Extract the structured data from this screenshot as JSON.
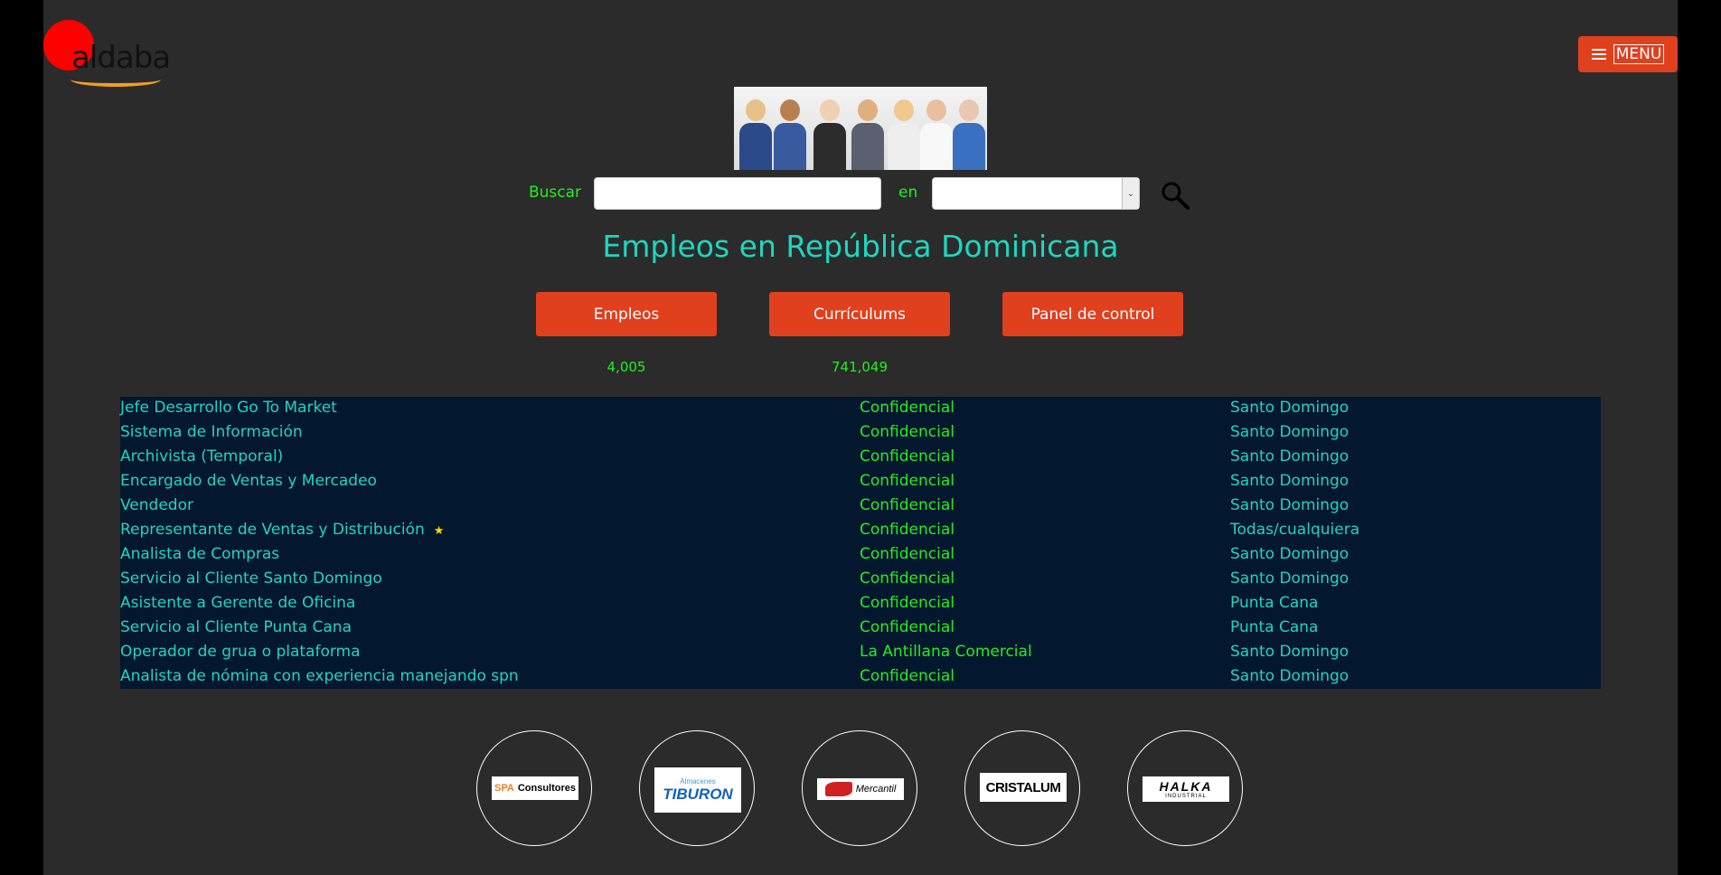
{
  "header": {
    "logo_text": "aldaba",
    "menu_label": "MENU"
  },
  "search": {
    "label": "Buscar",
    "query_value": "",
    "en_label": "en",
    "location_value": ""
  },
  "title": "Empleos en República Dominicana",
  "nav": {
    "jobs_label": "Empleos",
    "jobs_count": "4,005",
    "cv_label": "Currículums",
    "cv_count": "741,049",
    "panel_label": "Panel de control"
  },
  "jobs": [
    {
      "title": "Jefe Desarrollo Go To Market",
      "company": "Confidencial",
      "location": "Santo Domingo"
    },
    {
      "title": "Sistema de Información",
      "company": "Confidencial",
      "location": "Santo Domingo"
    },
    {
      "title": "Archivista (Temporal)",
      "company": "Confidencial",
      "location": "Santo Domingo"
    },
    {
      "title": "Encargado de Ventas y Mercadeo",
      "company": "Confidencial",
      "location": "Santo Domingo"
    },
    {
      "title": "Vendedor",
      "company": "Confidencial",
      "location": "Santo Domingo"
    },
    {
      "title": "Representante de Ventas y Distribución",
      "company": "Confidencial",
      "location": "Todas/cualquiera",
      "featured": true
    },
    {
      "title": "Analista de Compras",
      "company": "Confidencial",
      "location": "Santo Domingo"
    },
    {
      "title": "Servicio al Cliente Santo Domingo",
      "company": "Confidencial",
      "location": "Santo Domingo"
    },
    {
      "title": "Asistente a Gerente de Oficina",
      "company": "Confidencial",
      "location": "Punta Cana"
    },
    {
      "title": "Servicio al Cliente Punta Cana",
      "company": "Confidencial",
      "location": "Punta Cana"
    },
    {
      "title": "Operador de grua o plataforma",
      "company": "La Antillana Comercial",
      "location": "Santo Domingo"
    },
    {
      "title": "Analista de nómina con experiencia manejando spn",
      "company": "Confidencial",
      "location": "Santo Domingo"
    }
  ],
  "partners": [
    {
      "name": "SPA Consultores",
      "brand": "SPA",
      "rest": "Consultores"
    },
    {
      "name": "Almacenes Tiburon",
      "top": "Almacenes",
      "brand": "TIBURON"
    },
    {
      "name": "Mercantil",
      "brand": "Mercantil"
    },
    {
      "name": "Cristalum",
      "brand": "CRISTALUM"
    },
    {
      "name": "Halka Industrial",
      "brand": "HALKA",
      "sub": "INDUSTRIAL"
    }
  ],
  "colors": {
    "accent": "#e0401e",
    "teal": "#1fd6c0",
    "green": "#22ee22",
    "table_bg": "#03172e"
  }
}
